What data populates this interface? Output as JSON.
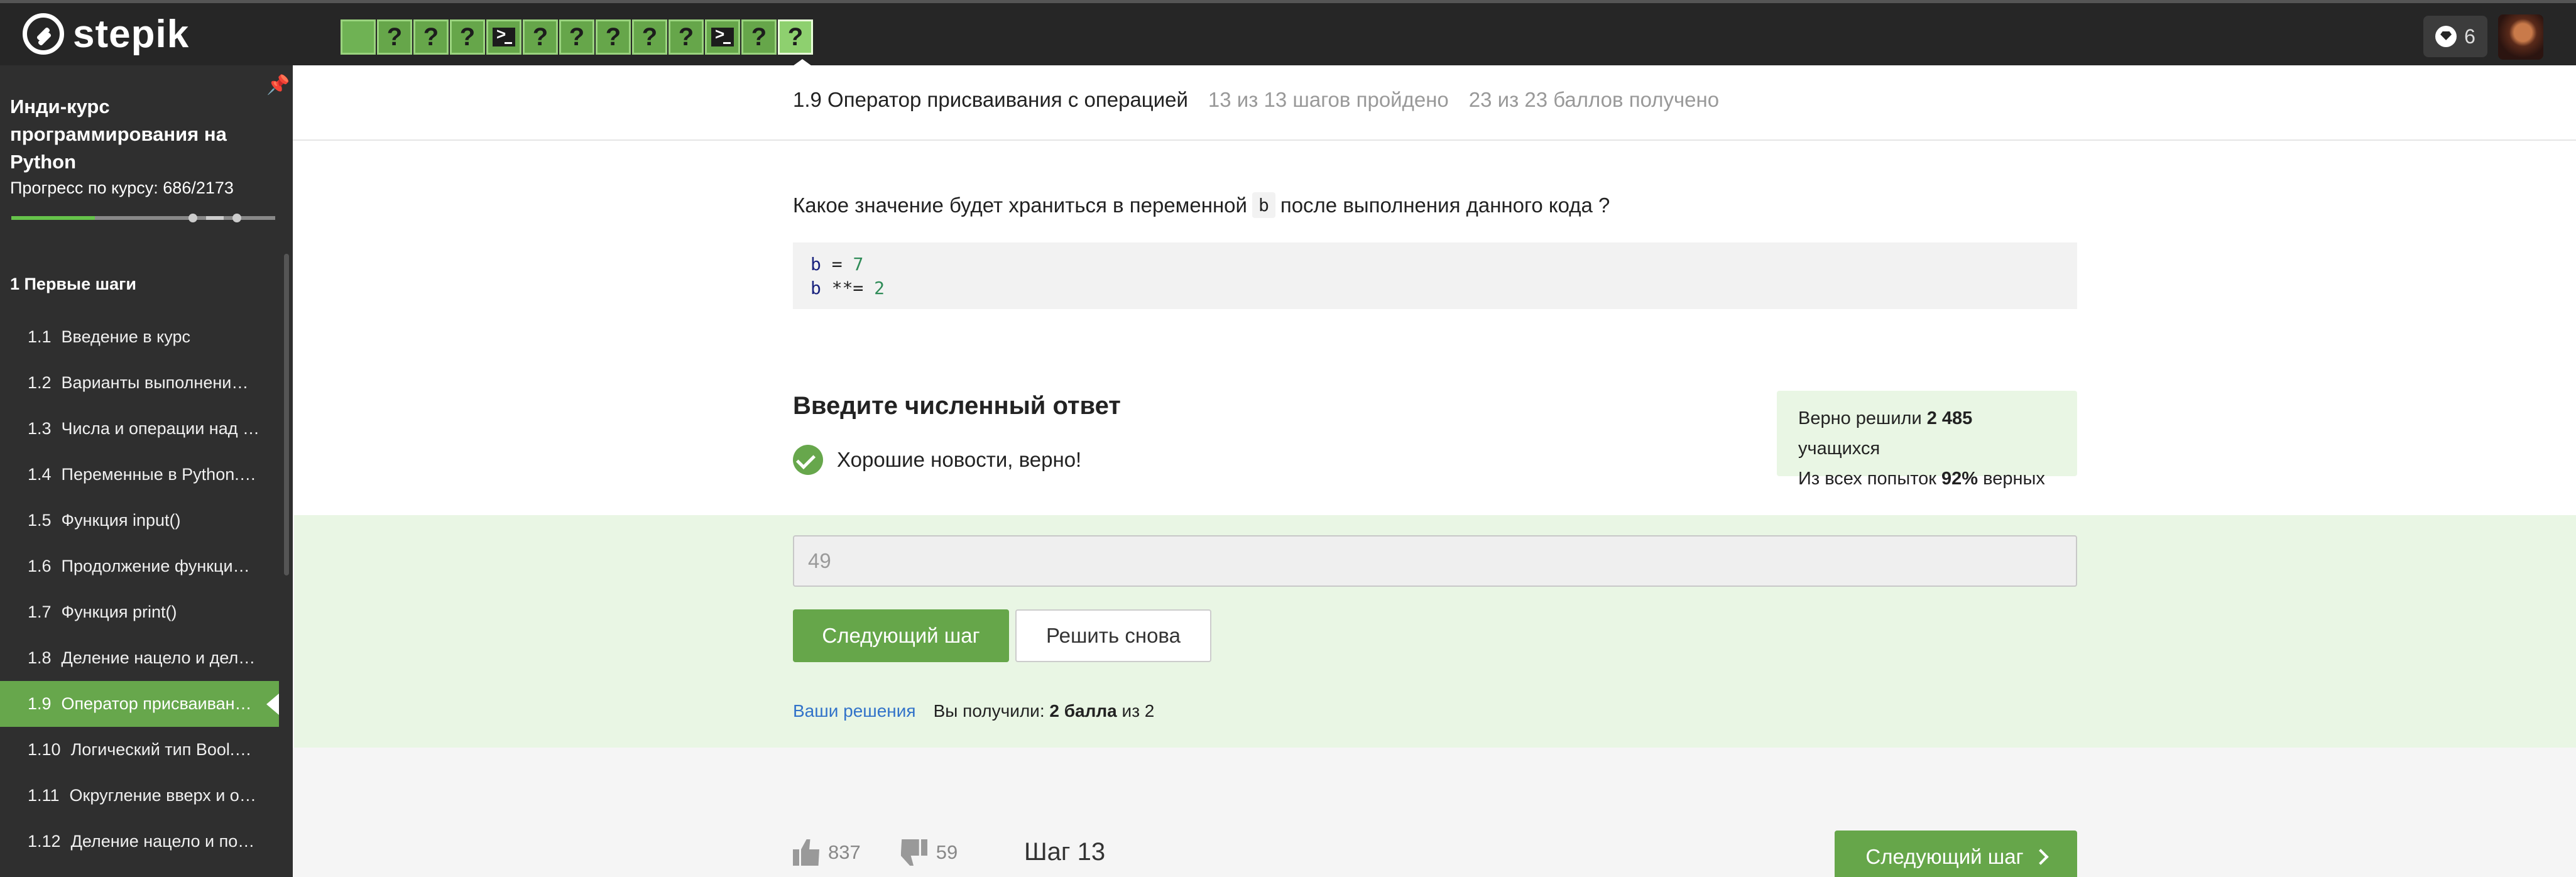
{
  "app": {
    "logo_text": "stepik"
  },
  "steps_bar": {
    "steps": [
      {
        "kind": "plain",
        "label": ""
      },
      {
        "kind": "quiz",
        "label": "?"
      },
      {
        "kind": "quiz",
        "label": "?"
      },
      {
        "kind": "quiz",
        "label": "?"
      },
      {
        "kind": "code",
        "label": ""
      },
      {
        "kind": "quiz",
        "label": "?"
      },
      {
        "kind": "quiz",
        "label": "?"
      },
      {
        "kind": "quiz",
        "label": "?"
      },
      {
        "kind": "quiz",
        "label": "?"
      },
      {
        "kind": "quiz",
        "label": "?"
      },
      {
        "kind": "code",
        "label": ""
      },
      {
        "kind": "quiz",
        "label": "?"
      },
      {
        "kind": "active",
        "label": "?"
      }
    ]
  },
  "header": {
    "notifications_count": "6"
  },
  "sidebar": {
    "course_title": "Инди-курс программирования на Python",
    "progress_label": "Прогресс по курсу:  686/2173",
    "progress_fraction": 0.316,
    "module_title": "1  Первые шаги",
    "lessons": [
      {
        "num": "1.1",
        "title": "Введение в курс"
      },
      {
        "num": "1.2",
        "title": "Варианты выполнени…"
      },
      {
        "num": "1.3",
        "title": "Числа и операции над …"
      },
      {
        "num": "1.4",
        "title": "Переменные в Python.…"
      },
      {
        "num": "1.5",
        "title": "Функция input()"
      },
      {
        "num": "1.6",
        "title": "Продолжение функци…"
      },
      {
        "num": "1.7",
        "title": "Функция print()"
      },
      {
        "num": "1.8",
        "title": "Деление нацело и дел…"
      },
      {
        "num": "1.9",
        "title": "Оператор присваиван…"
      },
      {
        "num": "1.10",
        "title": "Логический тип Bool.…"
      },
      {
        "num": "1.11",
        "title": "Округление вверх и о…"
      },
      {
        "num": "1.12",
        "title": "Деление нацело и по…"
      }
    ]
  },
  "lesson": {
    "title": "1.9 Оператор присваивания с операцией",
    "steps_done": "13 из 13 шагов пройдено",
    "points": "23 из 23 баллов  получено"
  },
  "question": {
    "before": "Какое значение будет храниться в переменной",
    "var": "b",
    "after": "после выполнения данного кода ?",
    "code_line1_var": "b",
    "code_line1_op": " = ",
    "code_line1_val": "7",
    "code_line2_var": "b",
    "code_line2_op": " **= ",
    "code_line2_val": "2"
  },
  "answer": {
    "heading": "Введите численный ответ",
    "feedback": "Хорошие новости, верно!",
    "value": "49",
    "next_button": "Следующий шаг",
    "retry_button": "Решить снова",
    "solutions_link": "Ваши решения",
    "score_prefix": "Вы получили:",
    "score_bold": "2 балла",
    "score_suffix": "из 2"
  },
  "stats": {
    "line1_prefix": "Верно решили",
    "line1_bold": "2 485",
    "line1_suffix": "учащихся",
    "line2_prefix": "Из всех попыток",
    "line2_bold": "92%",
    "line2_suffix": "верных"
  },
  "footer": {
    "likes": "837",
    "dislikes": "59",
    "step_label": "Шаг 13",
    "next_button": "Следующий шаг"
  }
}
